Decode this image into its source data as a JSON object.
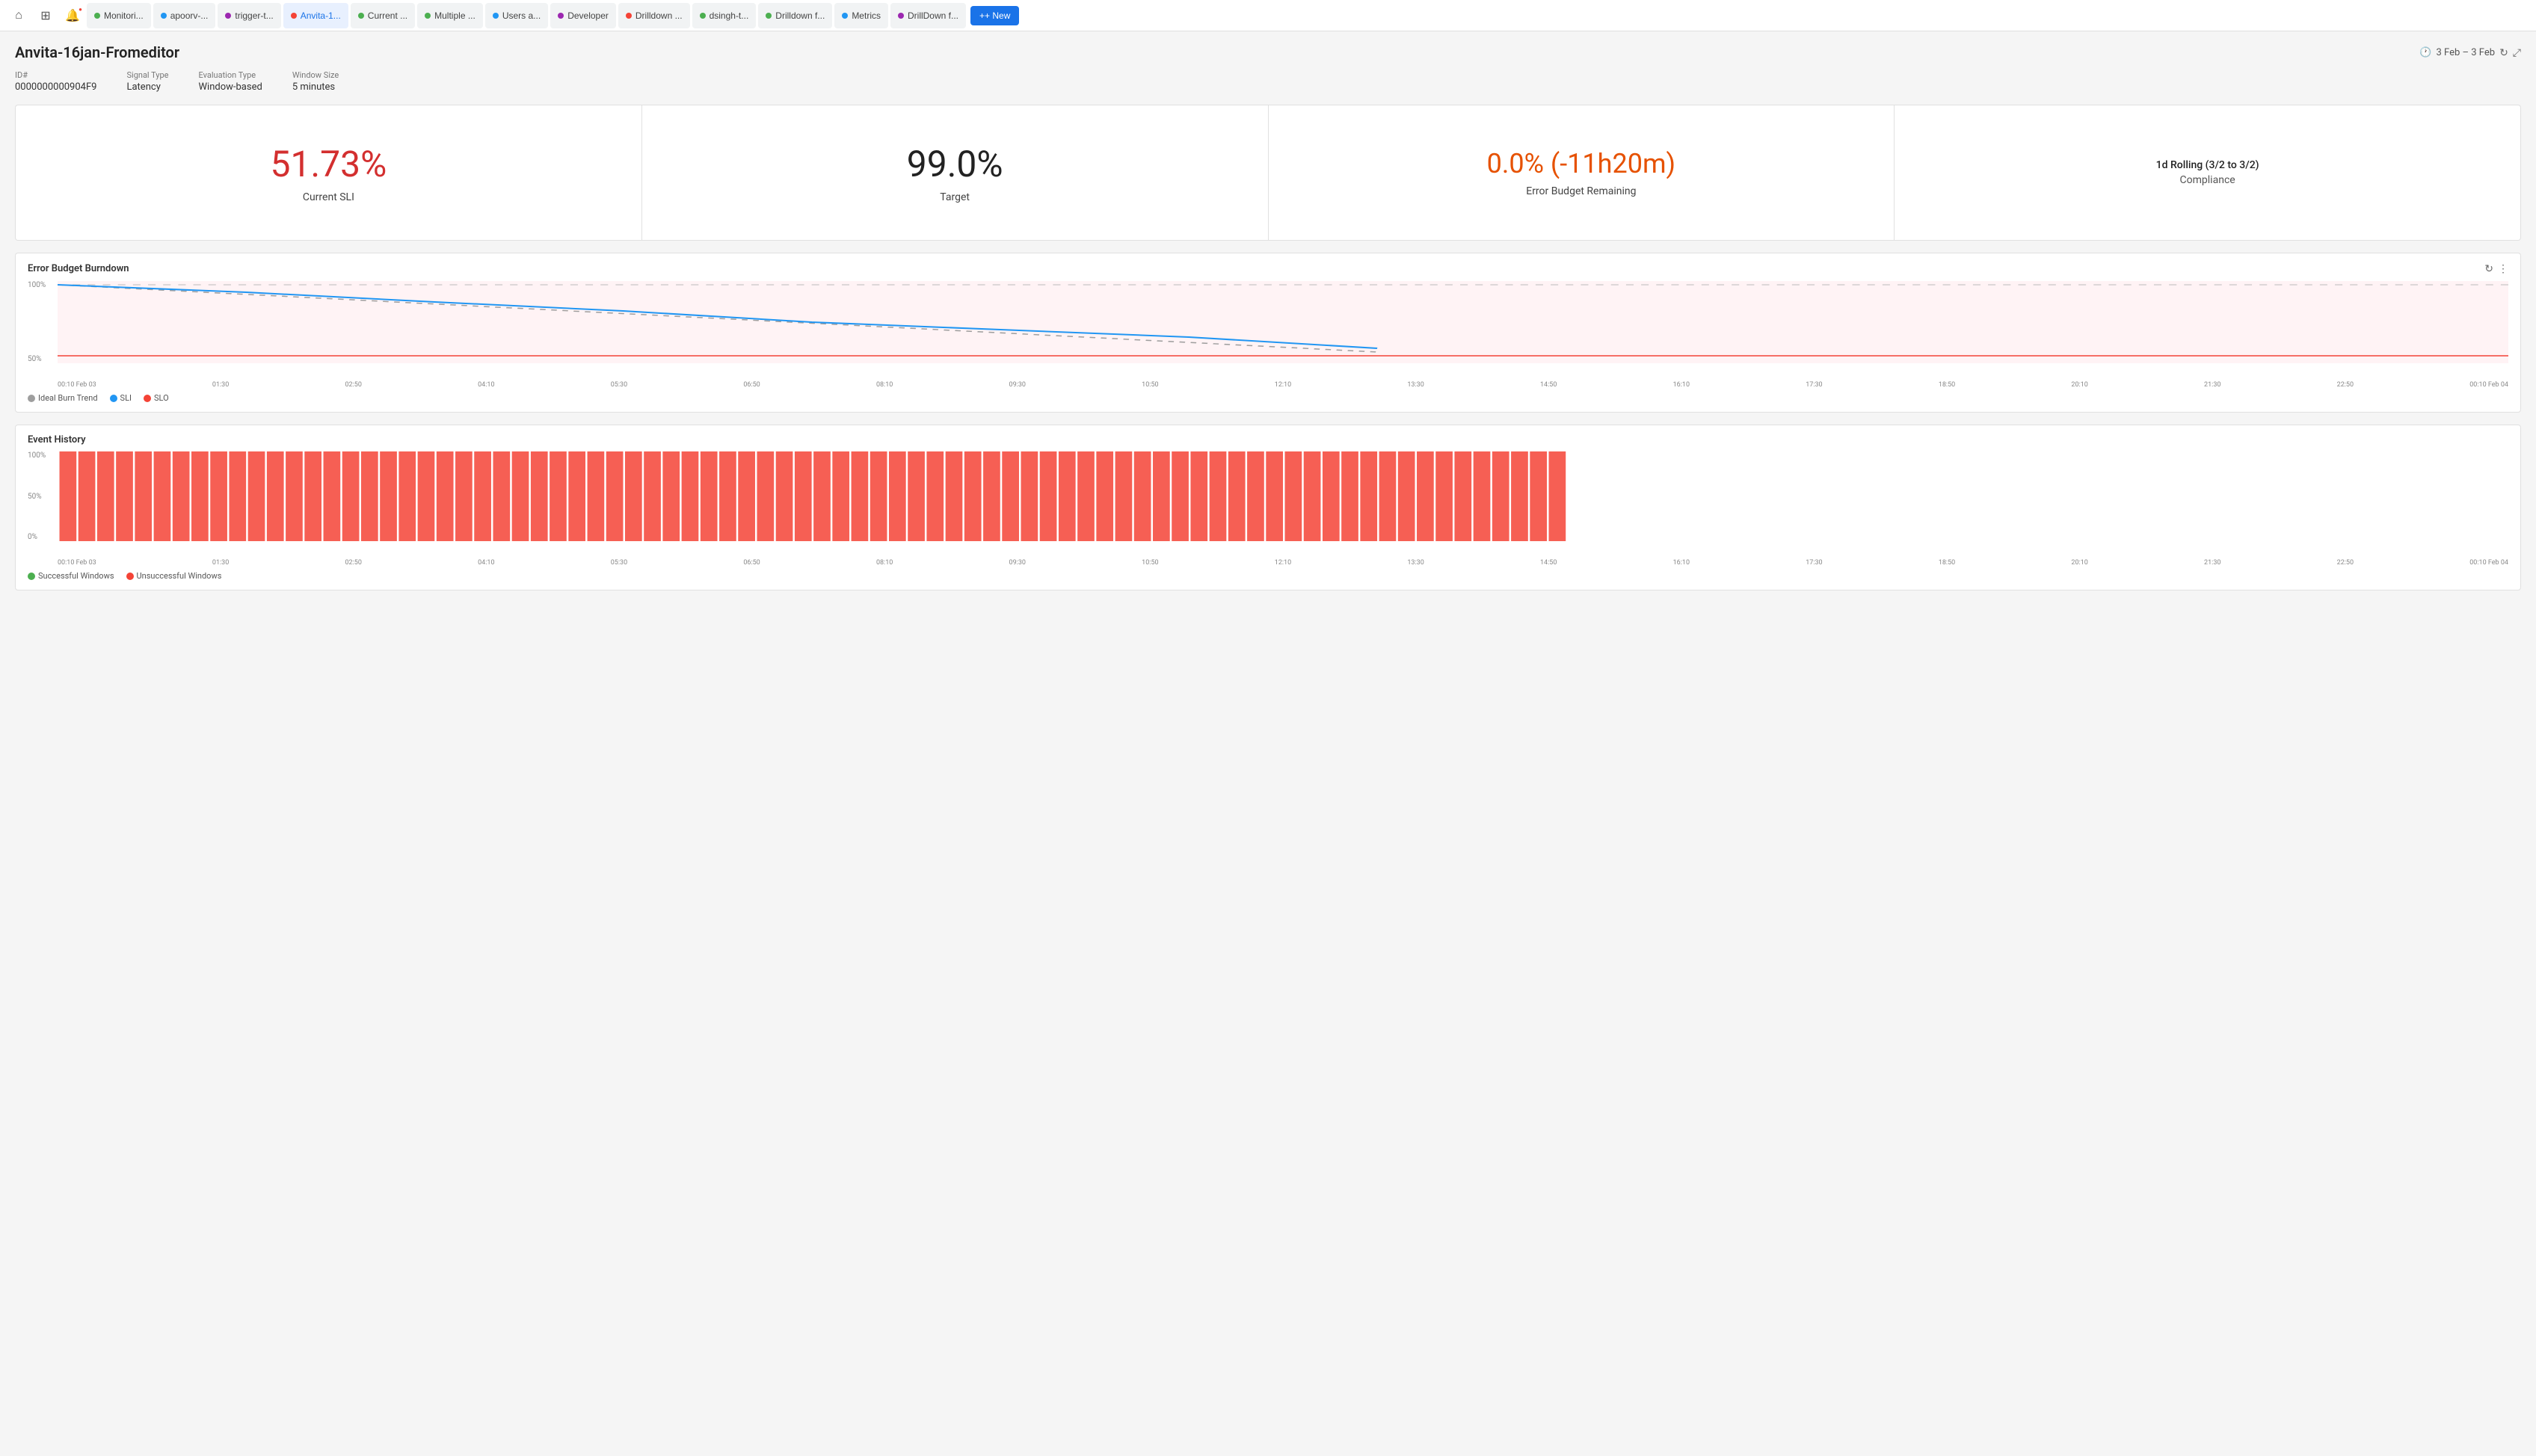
{
  "topnav": {
    "home_icon": "⌂",
    "grid_icon": "⊞",
    "alert_icon": "🔔",
    "new_label": "+ New",
    "tabs": [
      {
        "id": "monitoring",
        "label": "Monitori...",
        "color": "#4caf50",
        "active": false
      },
      {
        "id": "apoorv",
        "label": "apoorv-...",
        "color": "#2196f3",
        "active": false
      },
      {
        "id": "trigger-t",
        "label": "trigger-t...",
        "color": "#9c27b0",
        "active": false
      },
      {
        "id": "anvita-1",
        "label": "Anvita-1...",
        "color": "#f44336",
        "active": true
      },
      {
        "id": "current",
        "label": "Current ...",
        "color": "#4caf50",
        "active": false
      },
      {
        "id": "multiple",
        "label": "Multiple ...",
        "color": "#4caf50",
        "active": false
      },
      {
        "id": "users-a",
        "label": "Users a...",
        "color": "#2196f3",
        "active": false
      },
      {
        "id": "developer",
        "label": "Developer",
        "color": "#9c27b0",
        "active": false
      },
      {
        "id": "drilldown1",
        "label": "Drilldown ...",
        "color": "#f44336",
        "active": false
      },
      {
        "id": "dsingh-t",
        "label": "dsingh-t...",
        "color": "#4caf50",
        "active": false
      },
      {
        "id": "drilldown-f",
        "label": "Drilldown f...",
        "color": "#4caf50",
        "active": false
      },
      {
        "id": "metrics",
        "label": "Metrics",
        "color": "#2196f3",
        "active": false
      },
      {
        "id": "drilldown-f2",
        "label": "DrillDown f...",
        "color": "#9c27b0",
        "active": false
      }
    ]
  },
  "page": {
    "title": "Anvita-16jan-Fromeditor",
    "date_range": "3 Feb – 3 Feb",
    "id_label": "ID#",
    "id_value": "0000000000904F9",
    "signal_type_label": "Signal Type",
    "signal_type_value": "Latency",
    "eval_type_label": "Evaluation Type",
    "eval_type_value": "Window-based",
    "window_size_label": "Window Size",
    "window_size_value": "5 minutes"
  },
  "kpi": {
    "current_sli_value": "51.73%",
    "current_sli_label": "Current SLI",
    "target_value": "99.0%",
    "target_label": "Target",
    "error_budget_value": "0.0% (-11h20m)",
    "error_budget_label": "Error Budget Remaining",
    "compliance_subtitle": "1d Rolling (3/2 to 3/2)",
    "compliance_label": "Compliance"
  },
  "error_budget_chart": {
    "title": "Error Budget Burndown",
    "y_labels": [
      "100%",
      "50%"
    ],
    "x_labels": [
      "00:10 Feb 03",
      "01:30",
      "02:50",
      "04:10",
      "05:30",
      "06:50",
      "08:10",
      "09:30",
      "10:50",
      "12:10",
      "13:30",
      "14:50",
      "16:10",
      "17:30",
      "18:50",
      "20:10",
      "21:30",
      "22:50",
      "00:10 Feb 04"
    ],
    "legend": [
      {
        "label": "Ideal Burn Trend",
        "color": "#9e9e9e",
        "type": "line"
      },
      {
        "label": "SLI",
        "color": "#2196f3",
        "type": "line"
      },
      {
        "label": "SLO",
        "color": "#f44336",
        "type": "line"
      }
    ]
  },
  "event_history_chart": {
    "title": "Event History",
    "y_labels": [
      "100%",
      "50%",
      "0%"
    ],
    "x_labels": [
      "00:10 Feb 03",
      "01:30",
      "02:50",
      "04:10",
      "05:30",
      "06:50",
      "08:10",
      "09:30",
      "10:50",
      "12:10",
      "13:30",
      "14:50",
      "16:10",
      "17:30",
      "18:50",
      "20:10",
      "21:30",
      "22:50",
      "00:10 Feb 04"
    ],
    "legend": [
      {
        "label": "Successful Windows",
        "color": "#4caf50"
      },
      {
        "label": "Unsuccessful Windows",
        "color": "#f44336"
      }
    ]
  }
}
